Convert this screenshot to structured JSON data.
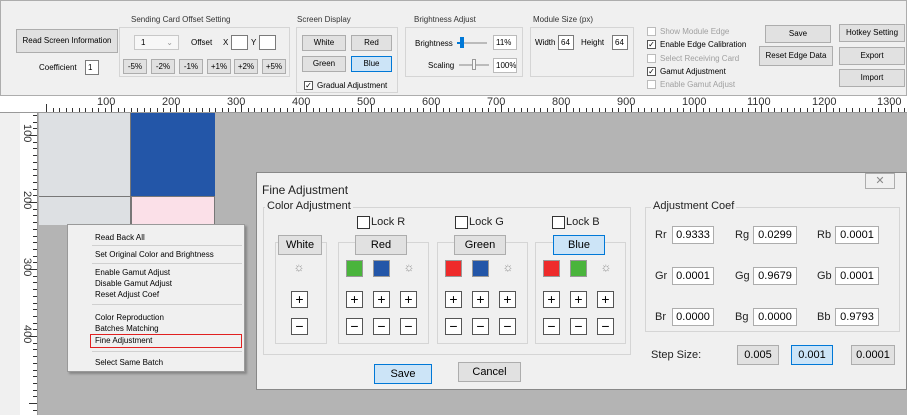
{
  "toolbar": {
    "read_screen_info": "Read Screen Information",
    "coefficient_label": "Coefficient",
    "coefficient_value": "1",
    "sending_card": {
      "title": "Sending Card Offset Setting",
      "select_value": "1",
      "offset_label": "Offset",
      "x_label": "X",
      "y_label": "Y",
      "x_value": "",
      "y_value": "",
      "pct_buttons": [
        "-5%",
        "-2%",
        "-1%",
        "+1%",
        "+2%",
        "+5%"
      ]
    },
    "screen_display": {
      "title": "Screen Display",
      "white": "White",
      "red": "Red",
      "green": "Green",
      "blue": "Blue",
      "gradual_label": "Gradual Adjustment",
      "gradual_checked": "✓"
    },
    "brightness": {
      "title": "Brightness Adjust",
      "brightness_label": "Brightness",
      "brightness_value": "11%",
      "brightness_level": 0.11,
      "scaling_label": "Scaling",
      "scaling_value": "100%",
      "scaling_level": 0.5
    },
    "module_size": {
      "title": "Module Size (px)",
      "width_label": "Width",
      "width_value": "64",
      "height_label": "Height",
      "height_value": "64"
    },
    "options": {
      "show_module_edge": "Show Module Edge",
      "enable_edge_calibration": "Enable Edge Calibration",
      "select_receiving_card": "Select Receiving Card",
      "gamut_adjustment": "Gamut Adjustment",
      "enable_gamut_adjust": "Enable Gamut Adjust",
      "check": "✓"
    },
    "save": "Save",
    "reset_edge_data": "Reset Edge Data",
    "hotkey_setting": "Hotkey Setting",
    "export": "Export",
    "import": "Import"
  },
  "ruler": {
    "h_labels": [
      "100",
      "200",
      "300",
      "400",
      "500",
      "600",
      "700",
      "800",
      "900",
      "1000",
      "1100",
      "1200",
      "1300"
    ],
    "v_labels": [
      "100",
      "200",
      "300",
      "400"
    ]
  },
  "canvas": {
    "colors": {
      "grey": "#dde0e3",
      "blue": "#2356a8",
      "pink": "#fbe0e8",
      "bg": "#b4b4b4"
    }
  },
  "context_menu": {
    "items": [
      "Read Back All",
      "Set Original Color and Brightness",
      "Enable Gamut Adjust",
      "Disable Gamut Adjust",
      "Reset Adjust Coef",
      "Color Reproduction",
      "Batches Matching",
      "Fine Adjustment",
      "Select Same Batch"
    ],
    "highlight_color": "#e02020"
  },
  "dialog": {
    "title": "Fine Adjustment",
    "close_label": "✕",
    "color_adjustment": {
      "title": "Color Adjustment",
      "lock_r": "Lock R",
      "lock_g": "Lock G",
      "lock_b": "Lock B",
      "white": "White",
      "red": "Red",
      "green": "Green",
      "blue": "Blue",
      "plus": "+",
      "minus": "−",
      "sun_glyph": "☼",
      "swatch_colors": {
        "red": "#ee2b2b",
        "green": "#4ab43c",
        "blue": "#2356a8"
      }
    },
    "coef": {
      "title": "Adjustment Coef",
      "rows": [
        [
          {
            "label": "Rr",
            "value": "0.9333"
          },
          {
            "label": "Rg",
            "value": "0.0299"
          },
          {
            "label": "Rb",
            "value": "0.0001"
          }
        ],
        [
          {
            "label": "Gr",
            "value": "0.0001"
          },
          {
            "label": "Gg",
            "value": "0.9679"
          },
          {
            "label": "Gb",
            "value": "0.0001"
          }
        ],
        [
          {
            "label": "Br",
            "value": "0.0000"
          },
          {
            "label": "Bg",
            "value": "0.0000"
          },
          {
            "label": "Bb",
            "value": "0.9793"
          }
        ]
      ]
    },
    "step_size_label": "Step Size:",
    "step_sizes": [
      "0.005",
      "0.001",
      "0.0001"
    ],
    "step_selected": "0.001",
    "save": "Save",
    "cancel": "Cancel"
  }
}
